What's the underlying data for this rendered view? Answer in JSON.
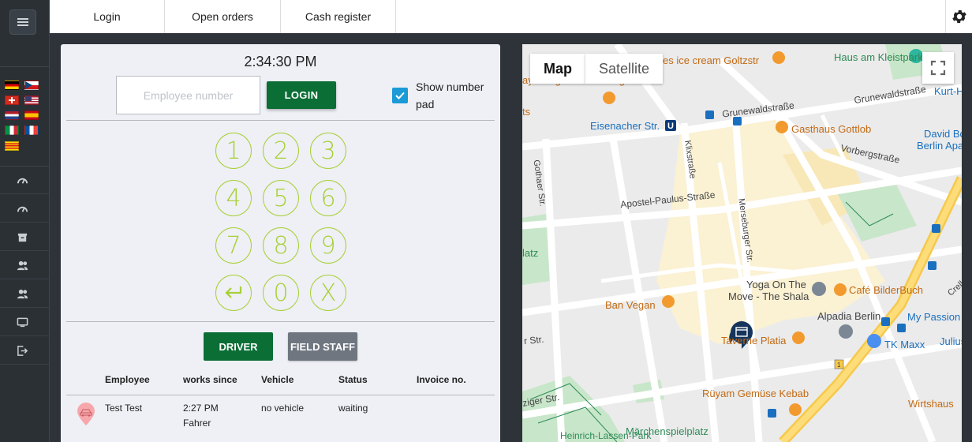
{
  "topbar": {
    "tabs": [
      {
        "label": "Login"
      },
      {
        "label": "Open orders"
      },
      {
        "label": "Cash register"
      }
    ]
  },
  "sidebar": {
    "flags": [
      "de",
      "cz",
      "ch",
      "us",
      "nl",
      "es",
      "it",
      "fr",
      "cat"
    ],
    "nav_icons": [
      "dashboard-icon",
      "dashboard-icon",
      "archive-icon",
      "users-icon",
      "users-icon",
      "monitor-icon",
      "logout-icon"
    ]
  },
  "login": {
    "clock": "2:34:30 PM",
    "employee_placeholder": "Employee number",
    "login_label": "LOGIN",
    "show_numpad_label": "Show number pad",
    "show_numpad_checked": true
  },
  "numpad": {
    "keys": [
      "1",
      "2",
      "3",
      "4",
      "5",
      "6",
      "7",
      "8",
      "9",
      "↵",
      "0",
      "X"
    ]
  },
  "staff_buttons": {
    "driver": "DRIVER",
    "field_staff": "FIELD STAFF"
  },
  "table": {
    "headers": {
      "employee": "Employee",
      "works_since": "works since",
      "vehicle": "Vehicle",
      "status": "Status",
      "invoice": "Invoice no."
    },
    "rows": [
      {
        "employee": "Test Test",
        "works_since": "2:27 PM",
        "role": "Fahrer",
        "vehicle": "no vehicle",
        "status": "waiting",
        "invoice": ""
      }
    ]
  },
  "map": {
    "type_map": "Map",
    "type_satellite": "Satellite",
    "labels": {
      "ice_cream": "es ice cream Goltzstr",
      "haus_kleistpark": "Haus am Kleistpark",
      "village": "ay Village Schöneberg",
      "eisenacher": "Eisenacher Str.",
      "grunewald1": "Grunewaldstraße",
      "grunewald2": "Grunewaldstraße",
      "kurt_hi": "Kurt-Hi",
      "gasthaus": "Gasthaus Gottlob",
      "david_bo": "David Bo",
      "berlin_apar": "Berlin Apar",
      "vorberg": "Vorbergstraße",
      "klix": "Klixstraße",
      "gothaer": "Gothaer Str.",
      "apostel": "Apostel-Paulus-Straße",
      "merseburger": "Merseburger Str.",
      "latz": "latz",
      "ts": "ts",
      "yoga1": "Yoga On The",
      "yoga2": "Move - The Shala",
      "cafe": "Café BilderBuch",
      "crelle": "Crelles",
      "ban_vegan": "Ban Vegan",
      "alpadia": "Alpadia Berlin",
      "my_passion": "My Passion",
      "julius": "Julius",
      "taverne": "Taverne Platia",
      "tk_maxx": "TK Maxx",
      "r_str": "r Str.",
      "ruyam": "Rüyam Gemüse Kebab",
      "wirtshaus": "Wirtshaus",
      "ziger": "ziger Str.",
      "maerchen": "Märchenspielplatz",
      "heinrich": "Heinrich-Lassen-Park"
    }
  }
}
